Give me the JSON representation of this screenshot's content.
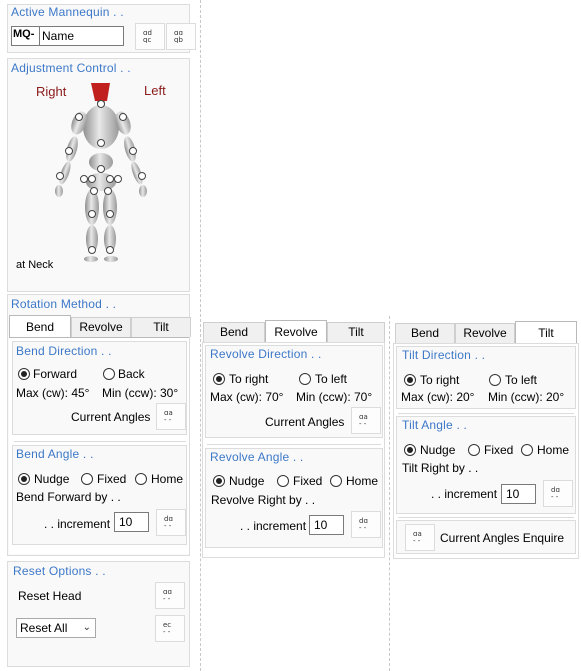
{
  "left_panel": {
    "active_mannequin": {
      "title": "Active Mannequin . .",
      "prefix": "MQ-",
      "name_value": "Name"
    },
    "adjustment": {
      "title": "Adjustment Control . .",
      "right_label": "Right",
      "left_label": "Left",
      "status": "at Neck"
    },
    "rotation_title": "Rotation Method . .",
    "tabs": [
      "Bend",
      "Revolve",
      "Tilt"
    ],
    "active_tab": "Bend",
    "direction": {
      "title": "Bend Direction . .",
      "option1": "Forward",
      "option2": "Back",
      "max": "Max (cw): 45°",
      "min": "Min (ccw): 30°",
      "current_angles": "Current Angles"
    },
    "angle": {
      "title": "Bend Angle . .",
      "nudge": "Nudge",
      "fixed": "Fixed",
      "home": "Home",
      "by_label": "Bend Forward by . .",
      "increment_label": ". . increment",
      "increment_value": "10"
    },
    "reset": {
      "title": "Reset Options . .",
      "reset_head": "Reset Head",
      "reset_select": "Reset All"
    }
  },
  "revolve_panel": {
    "tabs": [
      "Bend",
      "Revolve",
      "Tilt"
    ],
    "active_tab": "Revolve",
    "direction": {
      "title": "Revolve Direction . .",
      "option1": "To right",
      "option2": "To left",
      "max": "Max (cw): 70°",
      "min": "Min (ccw): 70°",
      "current_angles": "Current Angles"
    },
    "angle": {
      "title": "Revolve Angle . .",
      "nudge": "Nudge",
      "fixed": "Fixed",
      "home": "Home",
      "by_label": "Revolve Right by . .",
      "increment_label": ". . increment",
      "increment_value": "10"
    }
  },
  "tilt_panel": {
    "tabs": [
      "Bend",
      "Revolve",
      "Tilt"
    ],
    "active_tab": "Tilt",
    "direction": {
      "title": "Tilt Direction . .",
      "option1": "To right",
      "option2": "To left",
      "max": "Max (cw): 20°",
      "min": "Min (ccw): 20°"
    },
    "angle": {
      "title": "Tilt Angle . .",
      "nudge": "Nudge",
      "fixed": "Fixed",
      "home": "Home",
      "by_label": "Tilt Right by . .",
      "increment_label": ". . increment",
      "increment_value": "10"
    },
    "enquire_label": "Current Angles Enquire"
  },
  "colors": {
    "title_blue": "#3c78c8",
    "mannequin_label": "#8b1a1a",
    "head_red": "#c0201e"
  }
}
